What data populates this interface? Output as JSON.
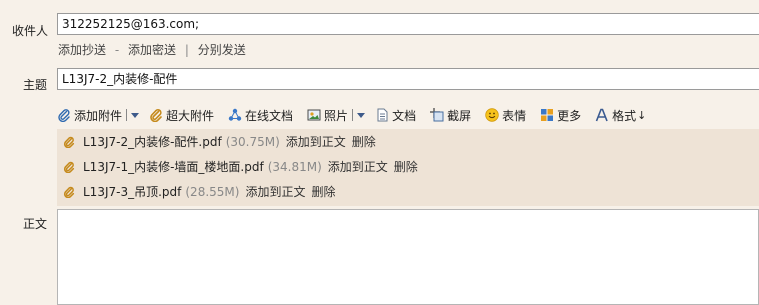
{
  "recipient": {
    "label": "收件人",
    "value": "312252125@163.com;",
    "links": [
      "添加抄送",
      "添加密送",
      "分别发送"
    ],
    "separators": [
      "-",
      "|"
    ]
  },
  "subject": {
    "label": "主题",
    "value": "L13J7-2_内装修-配件"
  },
  "toolbar": {
    "add_attachment": "添加附件",
    "large_attachment": "超大附件",
    "online_docs": "在线文档",
    "photo": "照片",
    "document": "文档",
    "screenshot": "截屏",
    "emoji": "表情",
    "more": "更多",
    "format": "格式"
  },
  "attachments": [
    {
      "name": "L13J7-2_内装修-配件.pdf",
      "size": "(30.75M)",
      "add": "添加到正文",
      "delete": "删除"
    },
    {
      "name": "L13J7-1_内装修-墙面_楼地面.pdf",
      "size": "(34.81M)",
      "add": "添加到正文",
      "delete": "删除"
    },
    {
      "name": "L13J7-3_吊顶.pdf",
      "size": "(28.55M)",
      "add": "添加到正文",
      "delete": "删除"
    }
  ],
  "body": {
    "label": "正文"
  },
  "icons": {
    "paperclip": "paperclip-icon",
    "large-attachment": "large-attachment-icon",
    "online-docs": "online-docs-icon",
    "photo": "photo-icon",
    "document": "document-icon",
    "screenshot": "screenshot-icon",
    "emoji": "emoji-icon",
    "more": "more-icon",
    "format": "format-icon"
  },
  "colors": {
    "background": "#f7f1e9",
    "attachment_panel": "#eee3d6",
    "caret": "#3d5a8a"
  }
}
